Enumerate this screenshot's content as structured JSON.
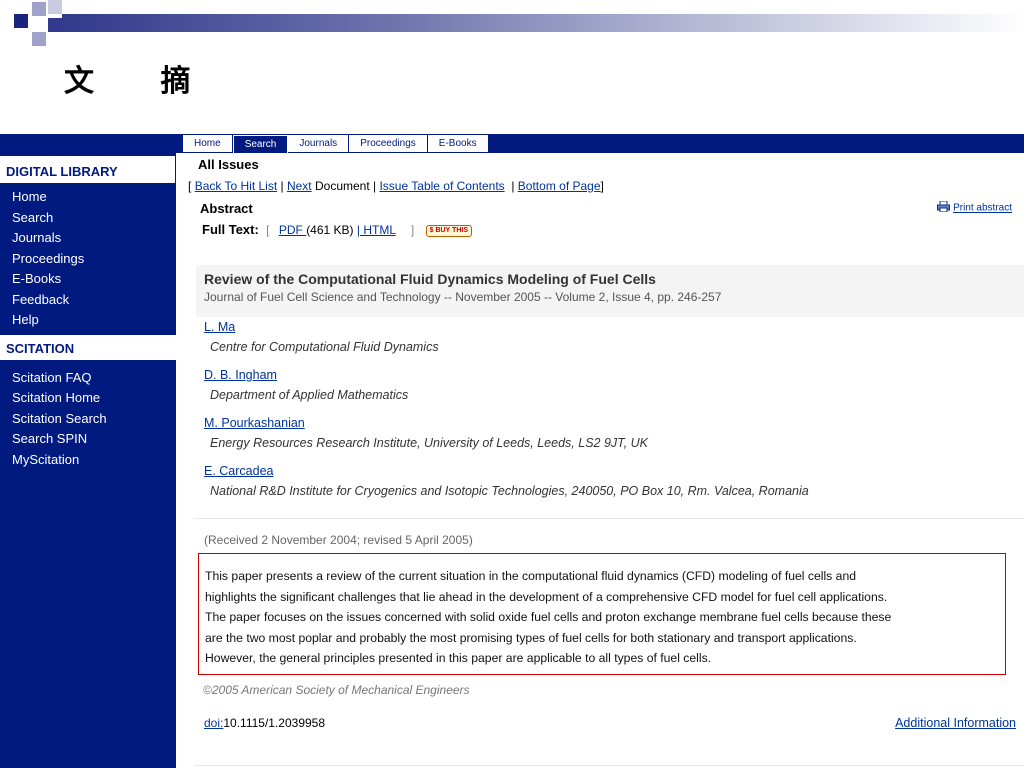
{
  "slide": {
    "title": "文 摘"
  },
  "nav": {
    "tabs": [
      "Home",
      "Search",
      "Journals",
      "Proceedings",
      "E-Books"
    ],
    "active": "Search"
  },
  "sidebar": {
    "digital_library": {
      "heading": "DIGITAL LIBRARY",
      "items": [
        "Home",
        "Search",
        "Journals",
        "Proceedings",
        "E-Books",
        "Feedback",
        "Help"
      ]
    },
    "scitation": {
      "heading": "SCITATION",
      "items": [
        "Scitation FAQ",
        "Scitation Home",
        "Scitation Search",
        "Search SPIN",
        "MyScitation"
      ]
    }
  },
  "main": {
    "section": "All Issues",
    "breadcrumb": {
      "open": "[",
      "back": "Back To Hit List",
      "sep1": " | ",
      "next": "Next",
      "document": " Document | ",
      "toc": "Issue Table of Contents",
      "sep2": "  | ",
      "bottom": "Bottom of Page",
      "close": "]"
    },
    "abstract_label": "Abstract",
    "print": "Print abstract",
    "fulltext": {
      "label": "Full Text:",
      "open": "[",
      "pdf": "PDF ",
      "pdf_size": "(461 KB)",
      "bar": "|",
      "html": " HTML",
      "close": "]",
      "buy": "$ BUY THIS"
    },
    "article": {
      "title": "Review of the Computational Fluid Dynamics Modeling of Fuel Cells",
      "source": "Journal of Fuel Cell Science and Technology -- November 2005 -- Volume 2, Issue 4, pp. 246-257"
    },
    "authors": [
      {
        "name": "L. Ma",
        "affiliation": "Centre for Computational Fluid Dynamics"
      },
      {
        "name": "D. B. Ingham",
        "affiliation": "Department of Applied Mathematics"
      },
      {
        "name": "M. Pourkashanian",
        "affiliation": "Energy Resources Research Institute, University of Leeds, Leeds, LS2 9JT, UK"
      },
      {
        "name": "E. Carcadea",
        "affiliation": "National R&D Institute for Cryogenics and Isotopic Technologies, 240050, PO Box 10, Rm. Valcea, Romania"
      }
    ],
    "received": "(Received 2 November 2004; revised 5 April 2005)",
    "abstract_lines": [
      "This paper presents a review of the current situation in the computational fluid dynamics (CFD) modeling of fuel cells and",
      "highlights the significant challenges that lie ahead in the development of a comprehensive CFD model for fuel cell applications.",
      "The paper focuses on the issues concerned with solid oxide fuel cells and proton exchange membrane fuel cells because these",
      "are the two most poplar and probably the most promising types of fuel cells for both stationary and transport applications.",
      "However, the general principles presented in this paper are applicable to all types of fuel cells."
    ],
    "copyright": "©2005 American Society of Mechanical Engineers",
    "doi_label": "doi:",
    "doi": "10.1115/1.2039958",
    "additional": "Additional Information"
  }
}
